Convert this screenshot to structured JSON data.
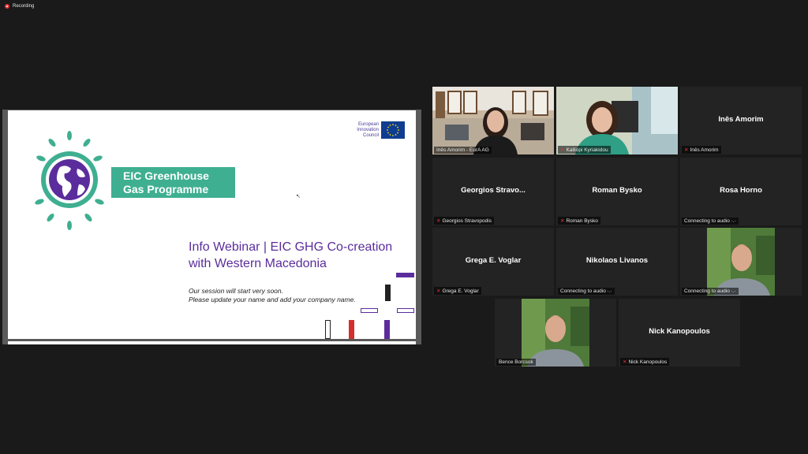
{
  "recording": {
    "label": "Recording"
  },
  "shared_screen": {
    "eu_logo_text": "European Innovation Council",
    "banner_line1": "EIC Greenhouse",
    "banner_line2": "Gas Programme",
    "title_line1": "Info Webinar | EIC GHG Co-creation",
    "title_line2": "with Western Macedonia",
    "subtitle_line1": "Our session will start very soon.",
    "subtitle_line2": "Please update your name and add your company name.",
    "colors": {
      "purple": "#5b2d9c",
      "green": "#3faf91",
      "red": "#d42e2e"
    }
  },
  "participants": [
    {
      "display_name": "",
      "label": "Inês Amorim - EurA AG",
      "muted": false,
      "video": true,
      "active_speaker": true
    },
    {
      "display_name": "",
      "label": "Kalliopi Kyriakidou",
      "muted": true,
      "video": true,
      "active_speaker": false
    },
    {
      "display_name": "Inês Amorim",
      "label": "Inês Amorim",
      "muted": true,
      "video": false
    },
    {
      "display_name": "Georgios  Stravo...",
      "label": "Georgios Stravopodis",
      "muted": true,
      "video": false
    },
    {
      "display_name": "Roman Bysko",
      "label": "Roman Bysko",
      "muted": true,
      "video": false
    },
    {
      "display_name": "Rosa Horno",
      "label": "Connecting to audio ·.·",
      "muted": false,
      "video": false
    },
    {
      "display_name": "Grega E. Voglar",
      "label": "Grega E. Voglar",
      "muted": true,
      "video": false
    },
    {
      "display_name": "Nikolaos Livanos",
      "label": "Connecting to audio ·.·",
      "muted": false,
      "video": false
    },
    {
      "display_name": "",
      "label": "Connecting to audio ·.·",
      "muted": false,
      "video": true
    },
    {
      "display_name": "",
      "label": "Bence Borcsok",
      "muted": false,
      "video": true
    },
    {
      "display_name": "Nick Kanopoulos",
      "label": "Nick Kanopoulos",
      "muted": true,
      "video": false
    }
  ]
}
